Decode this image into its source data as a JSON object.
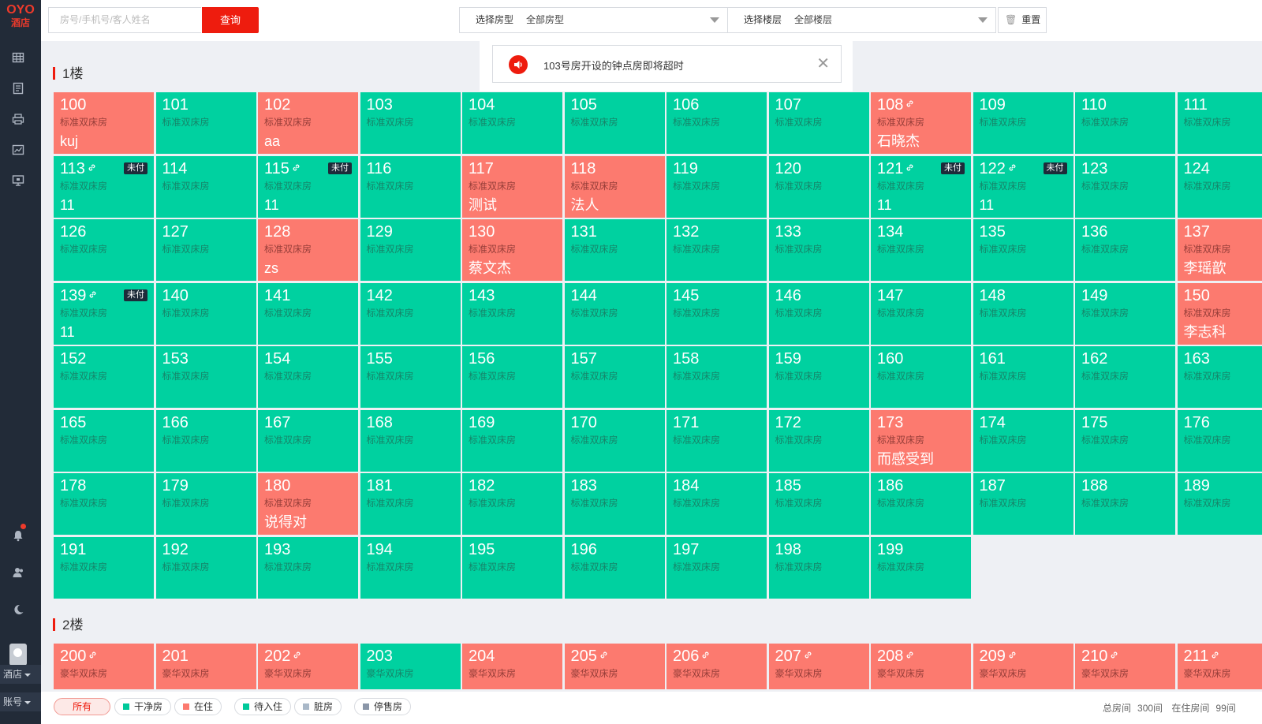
{
  "brand": {
    "line1": "OYO",
    "line2": "酒店"
  },
  "sidebar": {
    "icons": [
      "grid-icon",
      "document-icon",
      "printer-icon",
      "chart-icon",
      "monitor-icon",
      "bell-icon",
      "users-icon",
      "moon-icon"
    ],
    "menu": [
      "酒店",
      "账号"
    ]
  },
  "search": {
    "placeholder": "房号/手机号/客人姓名",
    "button": "查询"
  },
  "filters": [
    {
      "label": "选择房型",
      "value": "全部房型"
    },
    {
      "label": "选择楼层",
      "value": "全部楼层"
    }
  ],
  "reset": "重置",
  "notification": {
    "text": "103号房开设的钟点房即将超时"
  },
  "colors": {
    "clean": "#00d1a0",
    "occupied": "#fc7a6f",
    "accent": "#ee1c0e",
    "sidebar": "#222b38"
  },
  "floors": [
    {
      "title": "1楼",
      "rooms": [
        {
          "num": "100",
          "type": "标准双床房",
          "status": "occupied",
          "guest": "kuj"
        },
        {
          "num": "101",
          "type": "标准双床房",
          "status": "clean"
        },
        {
          "num": "102",
          "type": "标准双床房",
          "status": "occupied",
          "guest": "aa"
        },
        {
          "num": "103",
          "type": "标准双床房",
          "status": "clean"
        },
        {
          "num": "104",
          "type": "标准双床房",
          "status": "clean"
        },
        {
          "num": "105",
          "type": "标准双床房",
          "status": "clean"
        },
        {
          "num": "106",
          "type": "标准双床房",
          "status": "clean"
        },
        {
          "num": "107",
          "type": "标准双床房",
          "status": "clean"
        },
        {
          "num": "108",
          "type": "标准双床房",
          "status": "occupied",
          "guest": "石晓杰",
          "link": true
        },
        {
          "num": "109",
          "type": "标准双床房",
          "status": "clean"
        },
        {
          "num": "110",
          "type": "标准双床房",
          "status": "clean"
        },
        {
          "num": "111",
          "type": "标准双床房",
          "status": "clean"
        },
        {
          "num": "113",
          "type": "标准双床房",
          "status": "clean",
          "guest": "11",
          "link": true,
          "badge": "未付"
        },
        {
          "num": "114",
          "type": "标准双床房",
          "status": "clean"
        },
        {
          "num": "115",
          "type": "标准双床房",
          "status": "clean",
          "guest": "11",
          "link": true,
          "badge": "未付"
        },
        {
          "num": "116",
          "type": "标准双床房",
          "status": "clean"
        },
        {
          "num": "117",
          "type": "标准双床房",
          "status": "occupied",
          "guest": "测试"
        },
        {
          "num": "118",
          "type": "标准双床房",
          "status": "occupied",
          "guest": "法人"
        },
        {
          "num": "119",
          "type": "标准双床房",
          "status": "clean"
        },
        {
          "num": "120",
          "type": "标准双床房",
          "status": "clean"
        },
        {
          "num": "121",
          "type": "标准双床房",
          "status": "clean",
          "guest": "11",
          "link": true,
          "badge": "未付"
        },
        {
          "num": "122",
          "type": "标准双床房",
          "status": "clean",
          "guest": "11",
          "link": true,
          "badge": "未付"
        },
        {
          "num": "123",
          "type": "标准双床房",
          "status": "clean"
        },
        {
          "num": "124",
          "type": "标准双床房",
          "status": "clean"
        },
        {
          "num": "126",
          "type": "标准双床房",
          "status": "clean"
        },
        {
          "num": "127",
          "type": "标准双床房",
          "status": "clean"
        },
        {
          "num": "128",
          "type": "标准双床房",
          "status": "occupied",
          "guest": "zs"
        },
        {
          "num": "129",
          "type": "标准双床房",
          "status": "clean"
        },
        {
          "num": "130",
          "type": "标准双床房",
          "status": "occupied",
          "guest": "蔡文杰"
        },
        {
          "num": "131",
          "type": "标准双床房",
          "status": "clean"
        },
        {
          "num": "132",
          "type": "标准双床房",
          "status": "clean"
        },
        {
          "num": "133",
          "type": "标准双床房",
          "status": "clean"
        },
        {
          "num": "134",
          "type": "标准双床房",
          "status": "clean"
        },
        {
          "num": "135",
          "type": "标准双床房",
          "status": "clean"
        },
        {
          "num": "136",
          "type": "标准双床房",
          "status": "clean"
        },
        {
          "num": "137",
          "type": "标准双床房",
          "status": "occupied",
          "guest": "李瑶歆"
        },
        {
          "num": "139",
          "type": "标准双床房",
          "status": "clean",
          "guest": "11",
          "link": true,
          "badge": "未付"
        },
        {
          "num": "140",
          "type": "标准双床房",
          "status": "clean"
        },
        {
          "num": "141",
          "type": "标准双床房",
          "status": "clean"
        },
        {
          "num": "142",
          "type": "标准双床房",
          "status": "clean"
        },
        {
          "num": "143",
          "type": "标准双床房",
          "status": "clean"
        },
        {
          "num": "144",
          "type": "标准双床房",
          "status": "clean"
        },
        {
          "num": "145",
          "type": "标准双床房",
          "status": "clean"
        },
        {
          "num": "146",
          "type": "标准双床房",
          "status": "clean"
        },
        {
          "num": "147",
          "type": "标准双床房",
          "status": "clean"
        },
        {
          "num": "148",
          "type": "标准双床房",
          "status": "clean"
        },
        {
          "num": "149",
          "type": "标准双床房",
          "status": "clean"
        },
        {
          "num": "150",
          "type": "标准双床房",
          "status": "occupied",
          "guest": "李志科"
        },
        {
          "num": "152",
          "type": "标准双床房",
          "status": "clean"
        },
        {
          "num": "153",
          "type": "标准双床房",
          "status": "clean"
        },
        {
          "num": "154",
          "type": "标准双床房",
          "status": "clean"
        },
        {
          "num": "155",
          "type": "标准双床房",
          "status": "clean"
        },
        {
          "num": "156",
          "type": "标准双床房",
          "status": "clean"
        },
        {
          "num": "157",
          "type": "标准双床房",
          "status": "clean"
        },
        {
          "num": "158",
          "type": "标准双床房",
          "status": "clean"
        },
        {
          "num": "159",
          "type": "标准双床房",
          "status": "clean"
        },
        {
          "num": "160",
          "type": "标准双床房",
          "status": "clean"
        },
        {
          "num": "161",
          "type": "标准双床房",
          "status": "clean"
        },
        {
          "num": "162",
          "type": "标准双床房",
          "status": "clean"
        },
        {
          "num": "163",
          "type": "标准双床房",
          "status": "clean"
        },
        {
          "num": "165",
          "type": "标准双床房",
          "status": "clean"
        },
        {
          "num": "166",
          "type": "标准双床房",
          "status": "clean"
        },
        {
          "num": "167",
          "type": "标准双床房",
          "status": "clean"
        },
        {
          "num": "168",
          "type": "标准双床房",
          "status": "clean"
        },
        {
          "num": "169",
          "type": "标准双床房",
          "status": "clean"
        },
        {
          "num": "170",
          "type": "标准双床房",
          "status": "clean"
        },
        {
          "num": "171",
          "type": "标准双床房",
          "status": "clean"
        },
        {
          "num": "172",
          "type": "标准双床房",
          "status": "clean"
        },
        {
          "num": "173",
          "type": "标准双床房",
          "status": "occupied",
          "guest": "而感受到"
        },
        {
          "num": "174",
          "type": "标准双床房",
          "status": "clean"
        },
        {
          "num": "175",
          "type": "标准双床房",
          "status": "clean"
        },
        {
          "num": "176",
          "type": "标准双床房",
          "status": "clean"
        },
        {
          "num": "178",
          "type": "标准双床房",
          "status": "clean"
        },
        {
          "num": "179",
          "type": "标准双床房",
          "status": "clean"
        },
        {
          "num": "180",
          "type": "标准双床房",
          "status": "occupied",
          "guest": "说得对"
        },
        {
          "num": "181",
          "type": "标准双床房",
          "status": "clean"
        },
        {
          "num": "182",
          "type": "标准双床房",
          "status": "clean"
        },
        {
          "num": "183",
          "type": "标准双床房",
          "status": "clean"
        },
        {
          "num": "184",
          "type": "标准双床房",
          "status": "clean"
        },
        {
          "num": "185",
          "type": "标准双床房",
          "status": "clean"
        },
        {
          "num": "186",
          "type": "标准双床房",
          "status": "clean"
        },
        {
          "num": "187",
          "type": "标准双床房",
          "status": "clean"
        },
        {
          "num": "188",
          "type": "标准双床房",
          "status": "clean"
        },
        {
          "num": "189",
          "type": "标准双床房",
          "status": "clean"
        },
        {
          "num": "191",
          "type": "标准双床房",
          "status": "clean"
        },
        {
          "num": "192",
          "type": "标准双床房",
          "status": "clean"
        },
        {
          "num": "193",
          "type": "标准双床房",
          "status": "clean"
        },
        {
          "num": "194",
          "type": "标准双床房",
          "status": "clean"
        },
        {
          "num": "195",
          "type": "标准双床房",
          "status": "clean"
        },
        {
          "num": "196",
          "type": "标准双床房",
          "status": "clean"
        },
        {
          "num": "197",
          "type": "标准双床房",
          "status": "clean"
        },
        {
          "num": "198",
          "type": "标准双床房",
          "status": "clean"
        },
        {
          "num": "199",
          "type": "标准双床房",
          "status": "clean"
        }
      ]
    },
    {
      "title": "2楼",
      "rooms": [
        {
          "num": "200",
          "type": "豪华双床房",
          "status": "occupied",
          "link": true
        },
        {
          "num": "201",
          "type": "豪华双床房",
          "status": "occupied"
        },
        {
          "num": "202",
          "type": "豪华双床房",
          "status": "occupied",
          "link": true
        },
        {
          "num": "203",
          "type": "豪华双床房",
          "status": "clean"
        },
        {
          "num": "204",
          "type": "豪华双床房",
          "status": "occupied"
        },
        {
          "num": "205",
          "type": "豪华双床房",
          "status": "occupied",
          "link": true
        },
        {
          "num": "206",
          "type": "豪华双床房",
          "status": "occupied",
          "link": true
        },
        {
          "num": "207",
          "type": "豪华双床房",
          "status": "occupied",
          "link": true
        },
        {
          "num": "208",
          "type": "豪华双床房",
          "status": "occupied",
          "link": true
        },
        {
          "num": "209",
          "type": "豪华双床房",
          "status": "occupied",
          "link": true
        },
        {
          "num": "210",
          "type": "豪华双床房",
          "status": "occupied",
          "link": true
        },
        {
          "num": "211",
          "type": "豪华双床房",
          "status": "occupied",
          "link": true
        }
      ]
    }
  ],
  "legend": [
    {
      "label": "所有",
      "color": "",
      "active": true
    },
    {
      "label": "干净房",
      "color": "#00c99a"
    },
    {
      "label": "在住",
      "color": "#fc7a6f"
    },
    {
      "label": "待入住",
      "color": "#00c99a"
    },
    {
      "label": "脏房",
      "color": "#a9b8c8"
    },
    {
      "label": "停售房",
      "color": "#8a96a8"
    }
  ],
  "stats": {
    "total": "总房间",
    "total_value": "300间",
    "occupied": "在住房间",
    "occupied_value": "99间"
  }
}
